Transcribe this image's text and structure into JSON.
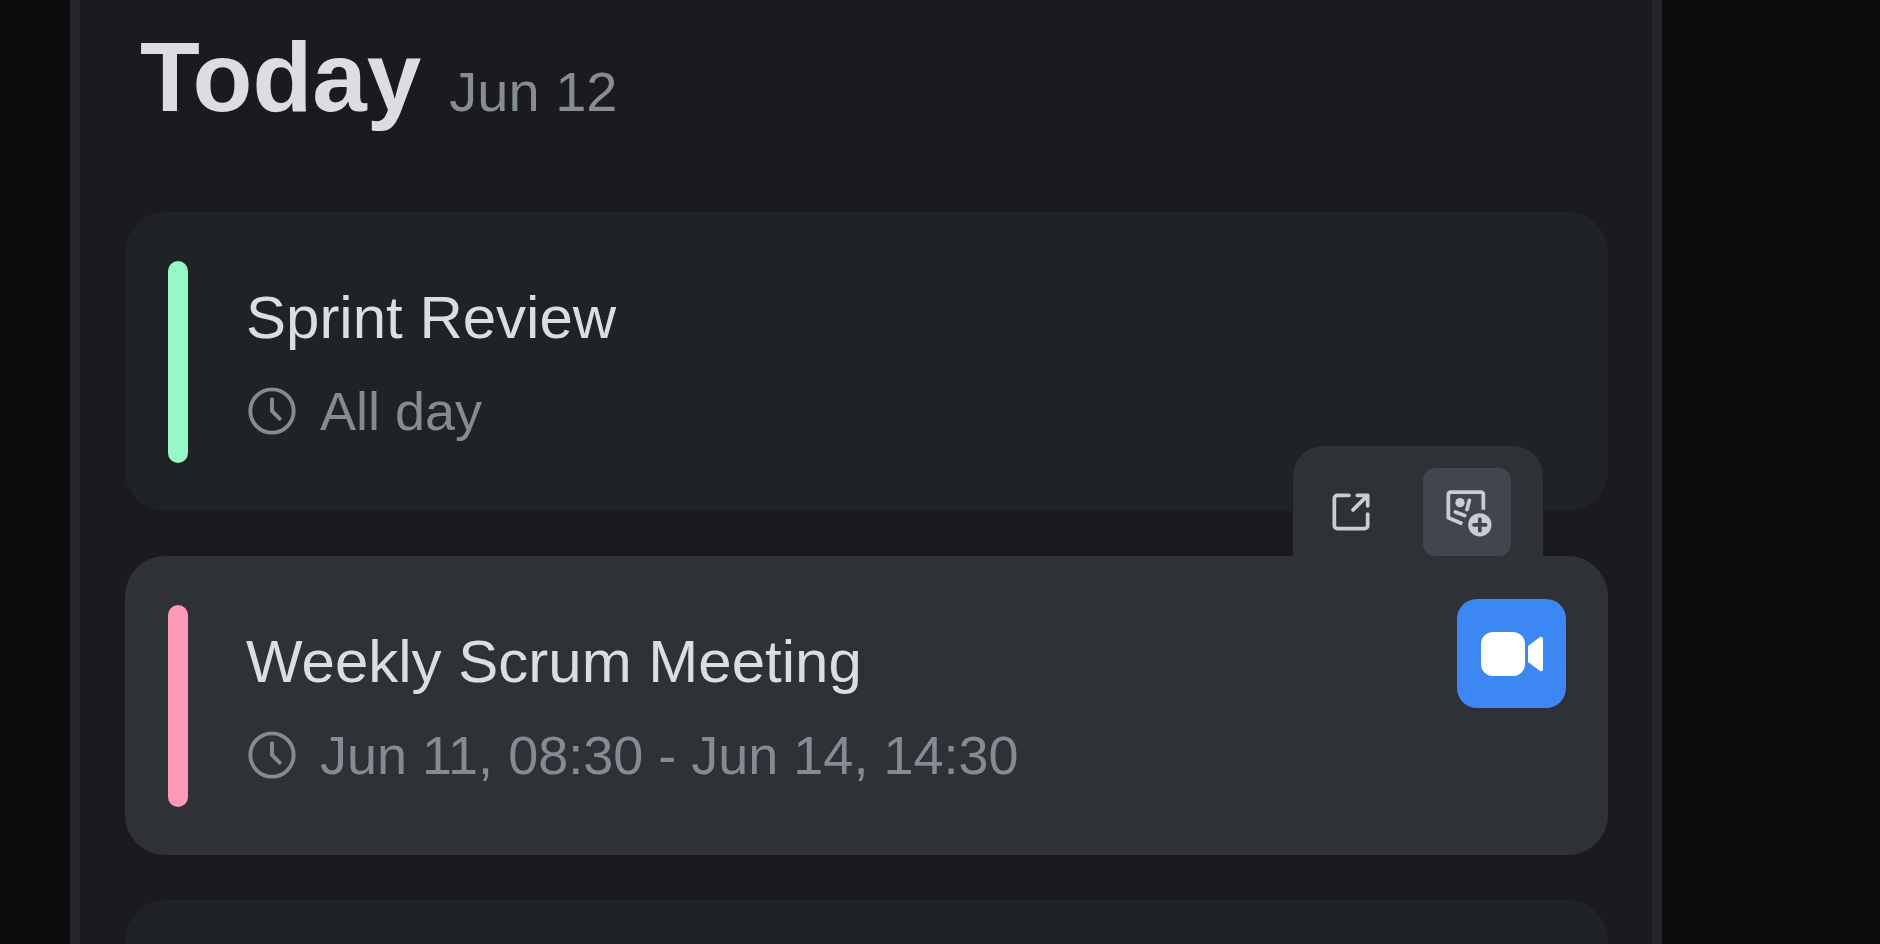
{
  "header": {
    "title": "Today",
    "date": "Jun 12"
  },
  "events": [
    {
      "title": "Sprint Review",
      "time": "All day",
      "color": "#96f7c8",
      "hovered": false,
      "video_call": false
    },
    {
      "title": "Weekly Scrum Meeting",
      "time": "Jun 11, 08:30 - Jun 14, 14:30",
      "color": "#ff99b8",
      "hovered": true,
      "video_call": true
    }
  ],
  "hover_toolbar": {
    "buttons": [
      {
        "kind": "open-external",
        "selected": false
      },
      {
        "kind": "add-person",
        "selected": true
      }
    ]
  }
}
